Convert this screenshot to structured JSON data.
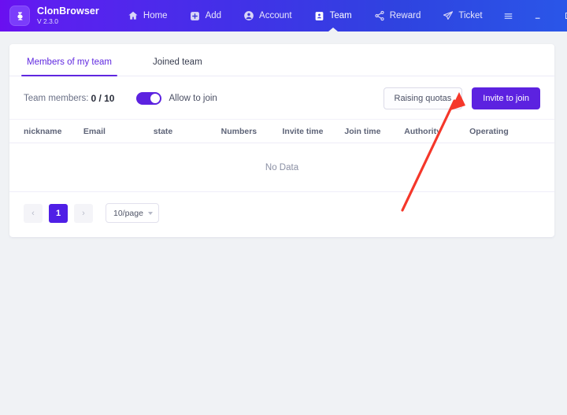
{
  "titlebar": {
    "logo_icon": "clonbrowser-logo-icon",
    "brand_name": "ClonBrowser",
    "version": "V 2.3.0",
    "nav": [
      {
        "label": "Home",
        "icon": "home-icon",
        "active": false
      },
      {
        "label": "Add",
        "icon": "add-icon",
        "active": false
      },
      {
        "label": "Account",
        "icon": "account-icon",
        "active": false
      },
      {
        "label": "Team",
        "icon": "team-icon",
        "active": true
      },
      {
        "label": "Reward",
        "icon": "share-icon",
        "active": false
      },
      {
        "label": "Ticket",
        "icon": "send-icon",
        "active": false
      }
    ],
    "window_controls": [
      {
        "name": "menu-button",
        "icon": "hamburger-icon"
      },
      {
        "name": "minimize-button",
        "icon": "minimize-icon"
      },
      {
        "name": "maximize-button",
        "icon": "maximize-icon"
      },
      {
        "name": "close-button",
        "icon": "close-icon"
      }
    ]
  },
  "tabs": [
    {
      "label": "Members of my team",
      "active": true
    },
    {
      "label": "Joined team",
      "active": false
    }
  ],
  "toolbar": {
    "members_label": "Team members:",
    "members_count": "0 / 10",
    "toggle_on": true,
    "toggle_label": "Allow to join",
    "raising_quotas_label": "Raising quotas",
    "invite_to_join_label": "Invite to join"
  },
  "table": {
    "columns": [
      "nickname",
      "Email",
      "state",
      "Numbers",
      "Invite time",
      "Join time",
      "Authority",
      "Operating"
    ],
    "rows": [],
    "empty_text": "No Data"
  },
  "pagination": {
    "prev_label": "‹",
    "next_label": "›",
    "current_page": "1",
    "page_size": "10/page"
  },
  "annotation": {
    "arrow_color": "#f5372a",
    "arrow_target": "Raising quotas"
  },
  "colors": {
    "accent": "#5c22e0",
    "header_left": "#6a0ff0",
    "header_right": "#2a56e8",
    "page_bg": "#f0f2f5"
  }
}
